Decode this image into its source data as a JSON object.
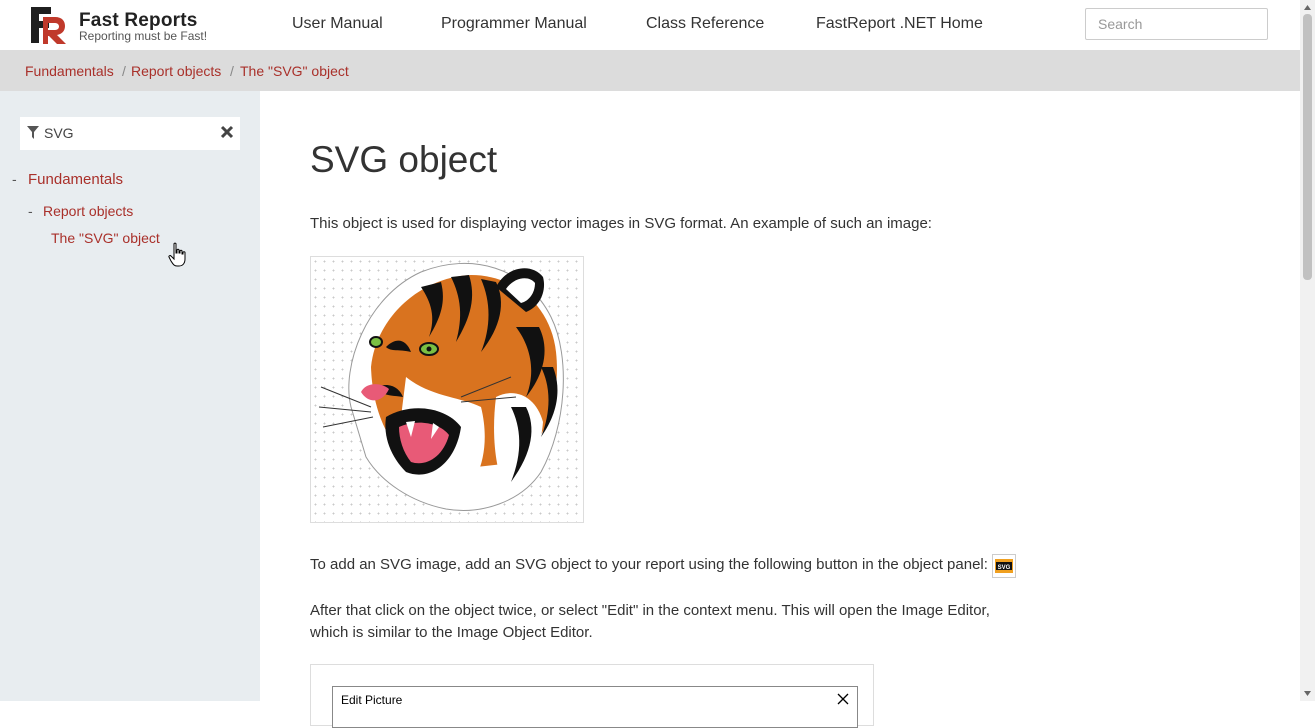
{
  "header": {
    "logo_title": "Fast Reports",
    "logo_subtitle": "Reporting must be Fast!",
    "nav": [
      "User Manual",
      "Programmer Manual",
      "Class Reference",
      "FastReport .NET Home"
    ],
    "search_placeholder": "Search"
  },
  "breadcrumb": [
    "Fundamentals",
    "Report objects",
    "The \"SVG\" object"
  ],
  "sidebar": {
    "filter_value": "SVG",
    "tree": {
      "level1": "Fundamentals",
      "level2": "Report objects",
      "level3": "The \"SVG\" object"
    }
  },
  "main": {
    "title": "SVG object",
    "intro": "This object is used for displaying vector images in SVG format. An example of such an image:",
    "add_text": "To add an SVG image, add an SVG object to your report using the following button in the object panel:",
    "svg_button_label": "SVG",
    "after_text_1": "After that click on the object twice, or select \"Edit\" in the context menu. This will open the Image Editor,",
    "after_text_2": "which is similar to the Image Object Editor.",
    "editor_title": "Edit Picture"
  },
  "colors": {
    "link": "#a9302a",
    "sidebar_bg": "#e8edf0",
    "breadcrumb_bg": "#dcdcdc"
  }
}
